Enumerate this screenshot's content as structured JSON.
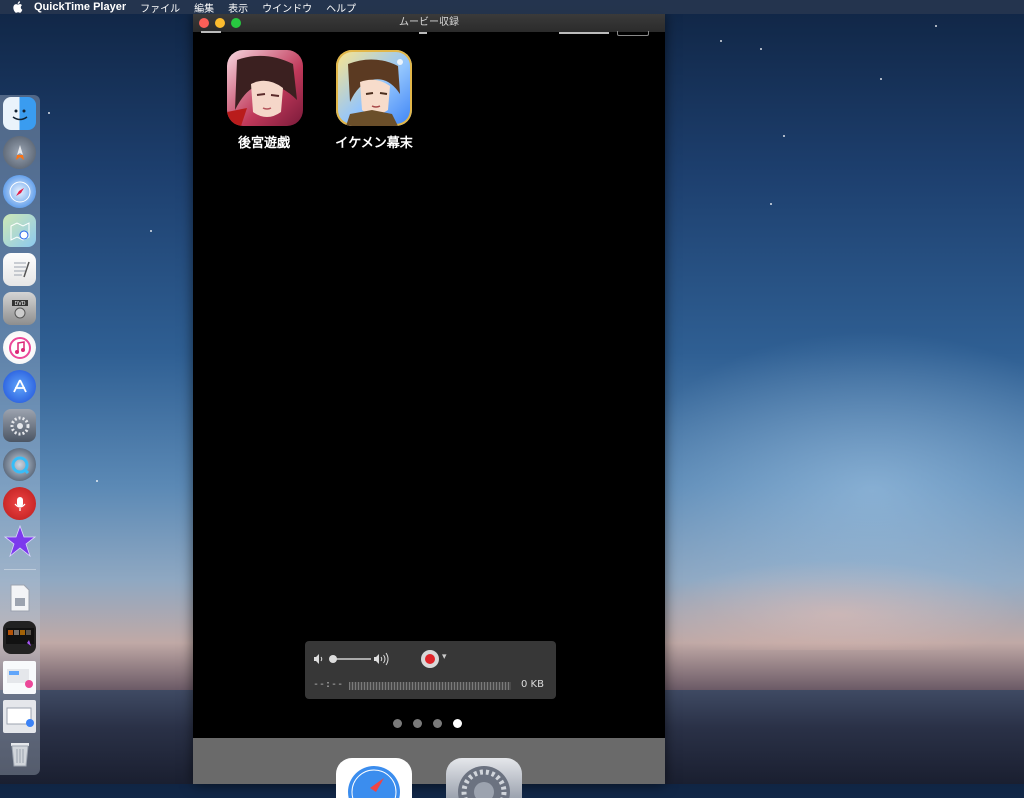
{
  "menubar": {
    "app_name": "QuickTime Player",
    "items": [
      "ファイル",
      "編集",
      "表示",
      "ウインドウ",
      "ヘルプ"
    ]
  },
  "window": {
    "title": "ムービー収録"
  },
  "apps": [
    {
      "label": "後宮遊戯",
      "icon": "anime-character-icon"
    },
    {
      "label": "イケメン幕末",
      "icon": "anime-character-icon"
    }
  ],
  "recording": {
    "time": "--:--",
    "size": "0 KB",
    "volume_level": 0
  },
  "pages": {
    "count": 4,
    "current": 4
  },
  "colors": {
    "record": "#e0252a",
    "close": "#fc5f57",
    "minimize": "#fdbc2e",
    "maximize": "#28c840"
  }
}
